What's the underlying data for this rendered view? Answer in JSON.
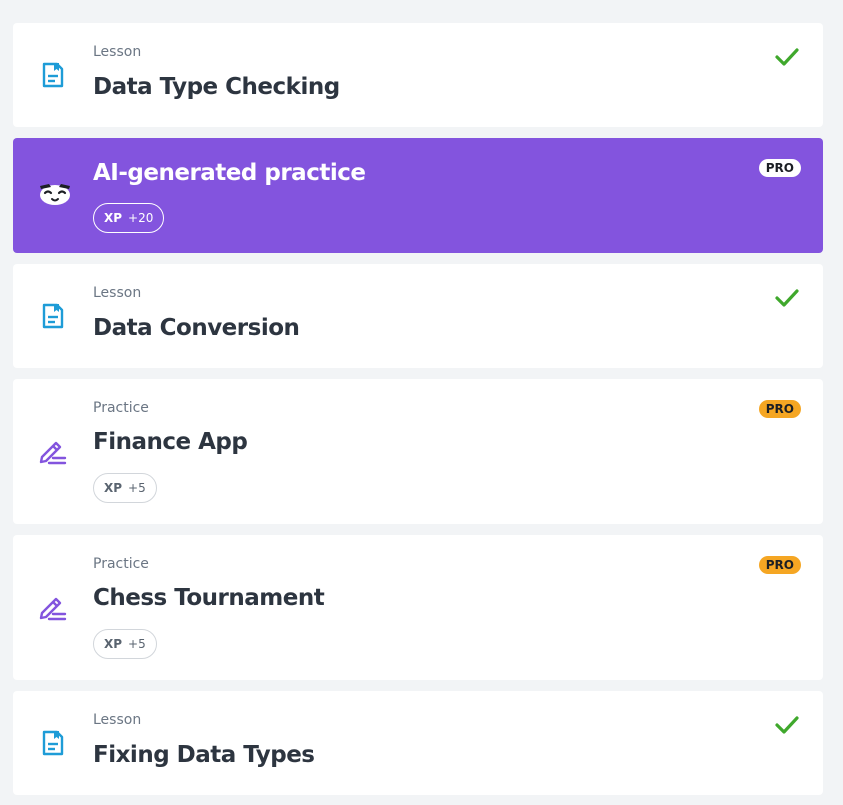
{
  "items": [
    {
      "kind": "lesson",
      "type_label": "Lesson",
      "title": "Data Type Checking",
      "completed": true,
      "icon": "document-icon"
    },
    {
      "kind": "ai",
      "title": "AI-generated practice",
      "badge": "PRO",
      "xp_label": "XP",
      "xp_amount": "+20",
      "icon": "mascot-icon"
    },
    {
      "kind": "lesson",
      "type_label": "Lesson",
      "title": "Data Conversion",
      "completed": true,
      "icon": "document-icon"
    },
    {
      "kind": "practice",
      "type_label": "Practice",
      "title": "Finance App",
      "badge": "PRO",
      "xp_label": "XP",
      "xp_amount": "+5",
      "icon": "pencil-icon"
    },
    {
      "kind": "practice",
      "type_label": "Practice",
      "title": "Chess Tournament",
      "badge": "PRO",
      "xp_label": "XP",
      "xp_amount": "+5",
      "icon": "pencil-icon"
    },
    {
      "kind": "lesson",
      "type_label": "Lesson",
      "title": "Fixing Data Types",
      "completed": true,
      "icon": "document-icon"
    }
  ],
  "colors": {
    "ai_card": "#8354de",
    "lesson_icon": "#1e9cd7",
    "practice_icon": "#8354de",
    "check": "#3fa82c",
    "pro_orange": "#f5a623"
  }
}
